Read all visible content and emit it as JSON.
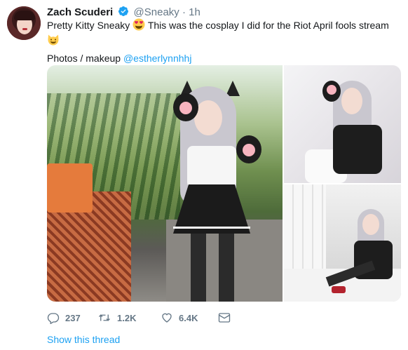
{
  "tweet": {
    "author_name": "Zach Scuderi",
    "handle": "@Sneaky",
    "separator": "·",
    "time": "1h",
    "text_line1": "Pretty Kitty Sneaky",
    "emoji1": "😍",
    "text_line1_rest": "This was the cosplay I did for the Riot April fools stream",
    "emoji2": "😺",
    "credits_prefix": "Photos / makeup",
    "credits_mention": "@estherlynnhhj"
  },
  "actions": {
    "reply_count": "237",
    "retweet_count": "1.2K",
    "like_count": "6.4K"
  },
  "show_thread": "Show this thread",
  "colors": {
    "link": "#1da1f2",
    "secondary_text": "#657786",
    "verified": "#1da1f2",
    "emoji_yellow": "#ffcc4d"
  },
  "icons": {
    "verified": "verified-badge-icon",
    "reply": "reply-icon",
    "retweet": "retweet-icon",
    "like": "heart-icon",
    "dm": "envelope-icon"
  }
}
